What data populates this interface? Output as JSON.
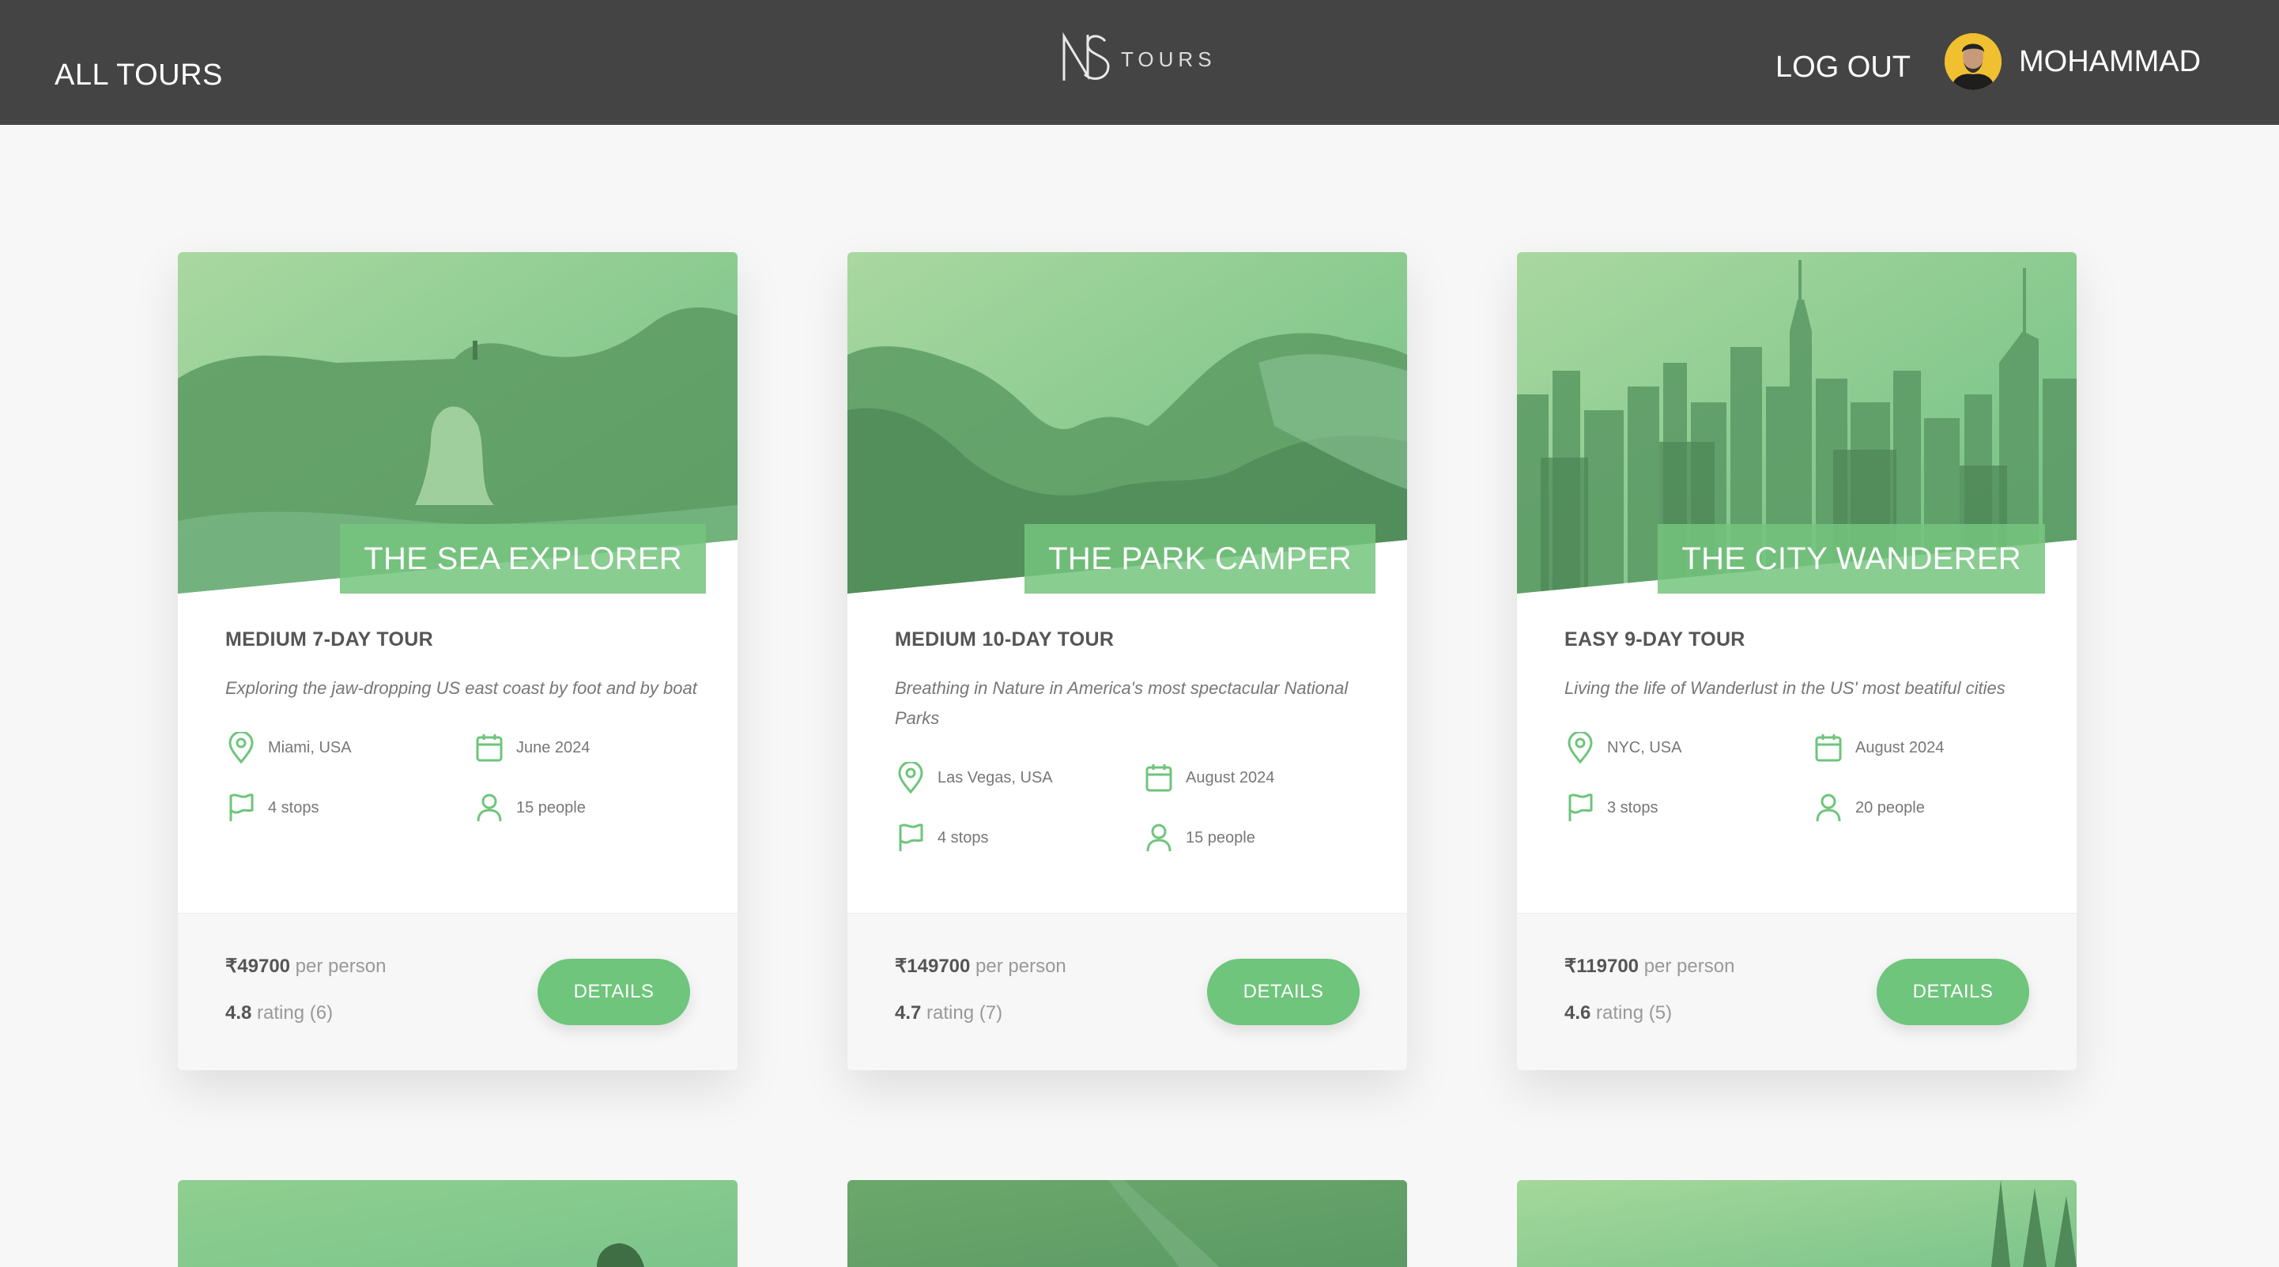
{
  "header": {
    "all_tours": "ALL TOURS",
    "logo_text": "TOURS",
    "logout": "LOG OUT",
    "user_name": "MOHAMMAD"
  },
  "colors": {
    "header_bg": "#444444",
    "accent_green": "#6ec57b",
    "page_bg": "#f7f7f7"
  },
  "cards": [
    {
      "title": "THE SEA EXPLORER",
      "subtitle": "MEDIUM 7-DAY TOUR",
      "description": "Exploring the jaw-dropping US east coast by foot and by boat",
      "location": "Miami, USA",
      "date": "June 2024",
      "stops": "4 stops",
      "people": "15 people",
      "price": "₹49700",
      "price_suffix": " per person",
      "rating": "4.8",
      "rating_suffix": " rating (6)",
      "button": "DETAILS"
    },
    {
      "title": "THE PARK CAMPER",
      "subtitle": "MEDIUM 10-DAY TOUR",
      "description": "Breathing in Nature in America's most spectacular National Parks",
      "location": "Las Vegas, USA",
      "date": "August 2024",
      "stops": "4 stops",
      "people": "15 people",
      "price": "₹149700",
      "price_suffix": " per person",
      "rating": "4.7",
      "rating_suffix": " rating (7)",
      "button": "DETAILS"
    },
    {
      "title": "THE CITY WANDERER",
      "subtitle": "EASY 9-DAY TOUR",
      "description": "Living the life of Wanderlust in the US' most beatiful cities",
      "location": "NYC, USA",
      "date": "August 2024",
      "stops": "3 stops",
      "people": "20 people",
      "price": "₹119700",
      "price_suffix": " per person",
      "rating": "4.6",
      "rating_suffix": " rating (5)",
      "button": "DETAILS"
    }
  ],
  "icons": {
    "location": "map-pin-icon",
    "date": "calendar-icon",
    "stops": "flag-icon",
    "people": "user-icon"
  }
}
